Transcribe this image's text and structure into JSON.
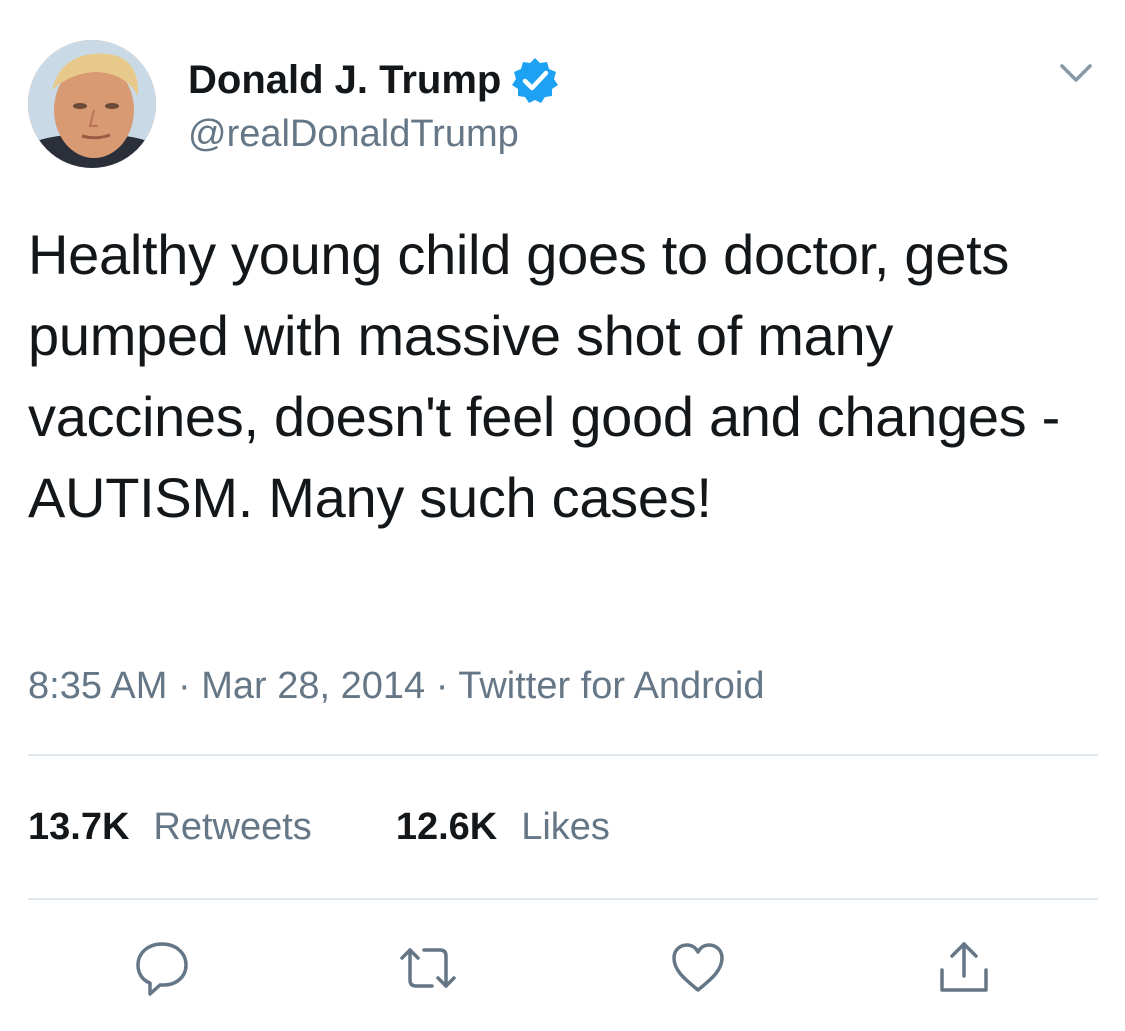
{
  "user": {
    "display_name": "Donald J. Trump",
    "handle": "@realDonaldTrump",
    "verified": true
  },
  "tweet": {
    "text": "Healthy young child goes to doctor, gets pumped with massive shot of many vaccines, doesn't feel good and changes - AUTISM. Many such cases!",
    "time": "8:35 AM",
    "separator": "·",
    "date": "Mar 28, 2014",
    "source": "Twitter for Android"
  },
  "stats": {
    "retweets_count": "13.7K",
    "retweets_label": "Retweets",
    "likes_count": "12.6K",
    "likes_label": "Likes"
  },
  "actions": {
    "icons": [
      "reply-icon",
      "retweet-icon",
      "like-icon",
      "share-icon"
    ]
  },
  "colors": {
    "text_primary": "#14171a",
    "text_secondary": "#657786",
    "verified_blue": "#1da1f2",
    "divider": "#e1e8ed"
  }
}
